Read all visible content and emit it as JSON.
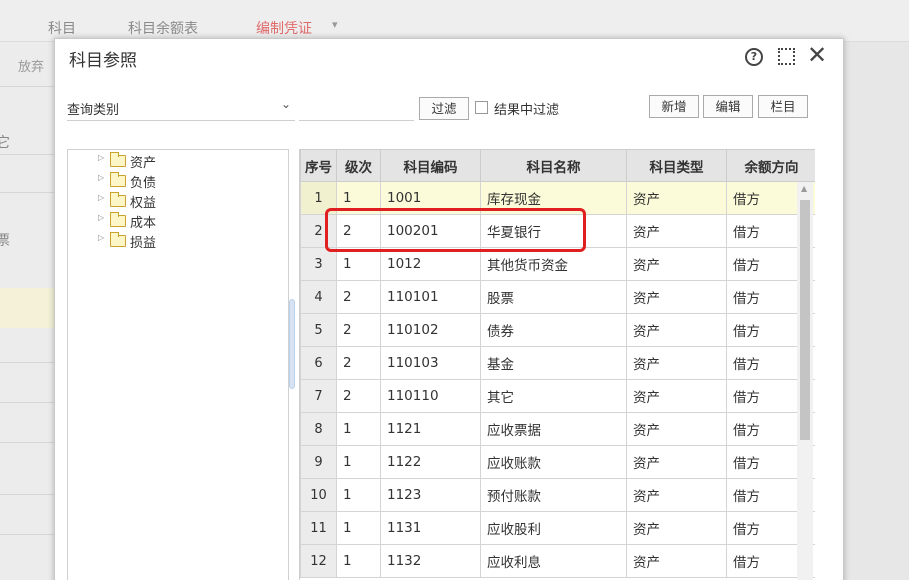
{
  "background": {
    "tabs": [
      {
        "label": "科目",
        "active": false
      },
      {
        "label": "科目余额表",
        "active": false
      },
      {
        "label": "编制凭证",
        "active": true
      }
    ],
    "left_text": "放弃",
    "left_glyph_1": "它",
    "left_glyph_2": "票"
  },
  "dialog": {
    "title": "科目参照",
    "help_symbol": "?",
    "close_symbol": "✕"
  },
  "toolbar": {
    "query_placeholder": "查询类别",
    "filter_button": "过滤",
    "filter_in_results": "结果中过滤",
    "new_button": "新增",
    "edit_button": "编辑",
    "columns_button": "栏目"
  },
  "tree": {
    "items": [
      {
        "label": "资产"
      },
      {
        "label": "负债"
      },
      {
        "label": "权益"
      },
      {
        "label": "成本"
      },
      {
        "label": "损益"
      }
    ]
  },
  "table": {
    "headers": [
      "序号",
      "级次",
      "科目编码",
      "科目名称",
      "科目类型",
      "余额方向"
    ],
    "rows": [
      [
        "1",
        "1",
        "1001",
        "库存现金",
        "资产",
        "借方"
      ],
      [
        "2",
        "2",
        "100201",
        "华夏银行",
        "资产",
        "借方"
      ],
      [
        "3",
        "1",
        "1012",
        "其他货币资金",
        "资产",
        "借方"
      ],
      [
        "4",
        "2",
        "110101",
        "股票",
        "资产",
        "借方"
      ],
      [
        "5",
        "2",
        "110102",
        "债券",
        "资产",
        "借方"
      ],
      [
        "6",
        "2",
        "110103",
        "基金",
        "资产",
        "借方"
      ],
      [
        "7",
        "2",
        "110110",
        "其它",
        "资产",
        "借方"
      ],
      [
        "8",
        "1",
        "1121",
        "应收票据",
        "资产",
        "借方"
      ],
      [
        "9",
        "1",
        "1122",
        "应收账款",
        "资产",
        "借方"
      ],
      [
        "10",
        "1",
        "1123",
        "预付账款",
        "资产",
        "借方"
      ],
      [
        "11",
        "1",
        "1131",
        "应收股利",
        "资产",
        "借方"
      ],
      [
        "12",
        "1",
        "1132",
        "应收利息",
        "资产",
        "借方"
      ]
    ],
    "selected_row": 1
  },
  "colors": {
    "accent_red": "#e02020",
    "selected_row_bg": "#fbfbd9",
    "active_tab": "#e06a6a"
  }
}
